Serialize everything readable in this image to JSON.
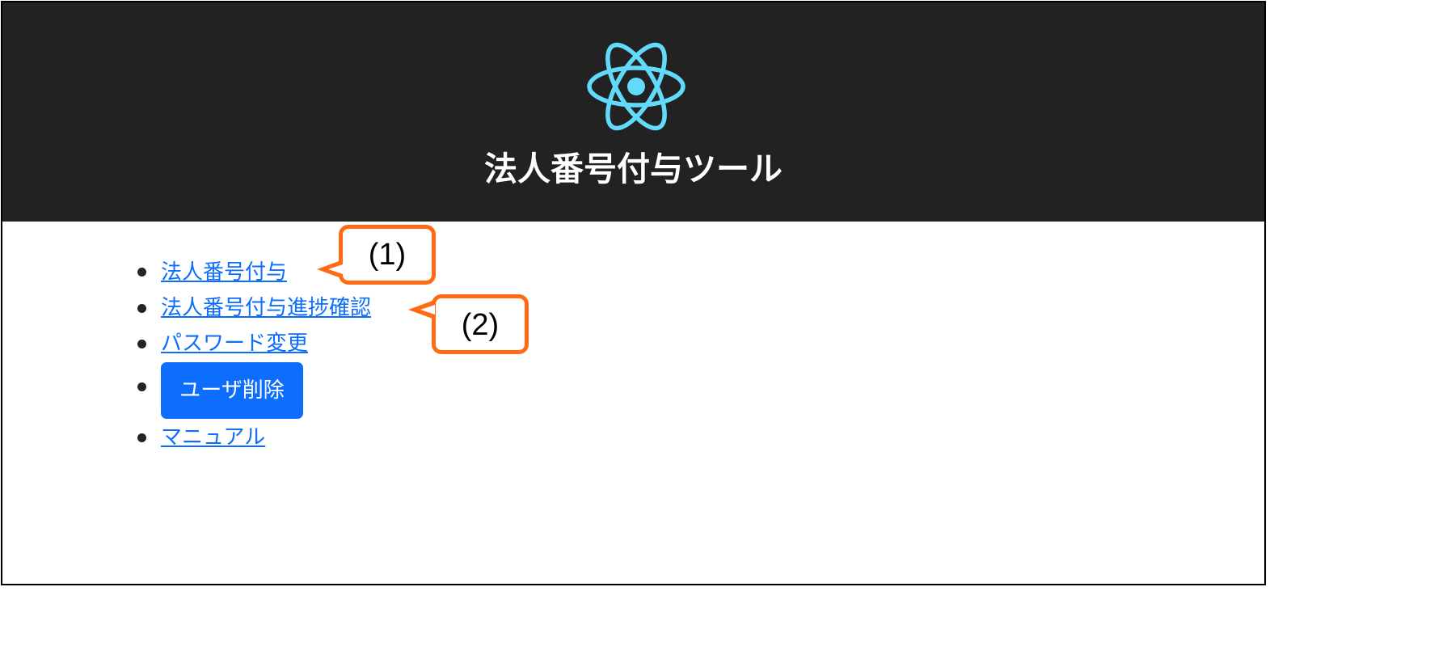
{
  "header": {
    "title": "法人番号付与ツール",
    "logo_icon": "react-atom-icon",
    "background_color": "#222222",
    "logo_color": "#61dafb"
  },
  "menu": {
    "items": [
      {
        "label": "法人番号付与",
        "type": "link"
      },
      {
        "label": "法人番号付与進捗確認",
        "type": "link"
      },
      {
        "label": "パスワード変更",
        "type": "link"
      },
      {
        "label": "ユーザ削除",
        "type": "button"
      },
      {
        "label": "マニュアル",
        "type": "link"
      }
    ],
    "link_color": "#0d6efd",
    "button_color": "#0d6efd"
  },
  "annotations": {
    "callouts": [
      {
        "label": "(1)"
      },
      {
        "label": "(2)"
      }
    ],
    "border_color": "#ff6a13"
  }
}
